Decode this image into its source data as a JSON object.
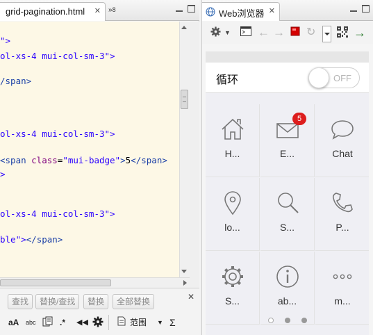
{
  "editor": {
    "tab_title": "grid-pagination.html",
    "overflow_count": "8",
    "code_lines": [
      {
        "kind": "str",
        "text": "\">"
      },
      {
        "kind": "str",
        "text": "ol-xs-4 mui-col-sm-3\">"
      },
      {
        "kind": "tag",
        "text": "/span>"
      },
      {
        "kind": "str",
        "text": "ol-xs-4 mui-col-sm-3\">"
      },
      {
        "kind": "badge_span",
        "tag": "<span ",
        "attr": "class",
        "eq": "=",
        "val": "\"mui-badge\"",
        "gt": ">",
        "num": "5",
        "close": "</span>"
      },
      {
        "kind": "str",
        "text": ">"
      },
      {
        "kind": "str",
        "text": "ol-xs-4 mui-col-sm-3\">"
      },
      {
        "kind": "mixed",
        "str": "ble\">",
        "tag": "</span>"
      }
    ]
  },
  "findbar": {
    "find": "查找",
    "replace_find": "替换/查找",
    "replace": "替换",
    "replace_all": "全部替换",
    "case_toggle": "aA",
    "word_toggle": "abc",
    "regex_toggle": ".*",
    "scope_label": "范围"
  },
  "browser": {
    "tab_title": "Web浏览器",
    "loop_label": "循环",
    "switch_state": "OFF",
    "grid": [
      {
        "icon": "home-icon",
        "label": "H..."
      },
      {
        "icon": "email-icon",
        "label": "E...",
        "badge": "5"
      },
      {
        "icon": "chat-icon",
        "label": "Chat"
      },
      {
        "icon": "location-icon",
        "label": "lo..."
      },
      {
        "icon": "search-icon",
        "label": "S..."
      },
      {
        "icon": "phone-icon",
        "label": "P..."
      },
      {
        "icon": "gear-icon",
        "label": "S..."
      },
      {
        "icon": "info-icon",
        "label": "ab..."
      },
      {
        "icon": "more-icon",
        "label": "m..."
      }
    ],
    "pagination": {
      "pages": 3,
      "active": 1
    }
  },
  "colors": {
    "editor_bg": "#fdf8e6",
    "code_string": "#2a00ff",
    "code_tag": "#1b3fa6",
    "code_attr": "#7f007f",
    "badge": "#dd1d1d",
    "stop_button": "#d40000",
    "go_button": "#2e7d32"
  }
}
